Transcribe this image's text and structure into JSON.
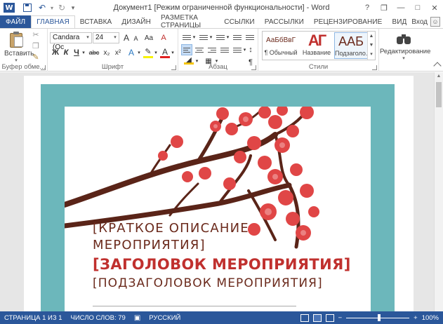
{
  "window": {
    "title": "Документ1 [Режим ограниченной функциональности] - Word",
    "controls": {
      "help": "?",
      "restore": "❐",
      "minimize": "—",
      "maximize": "□",
      "close": "✕"
    }
  },
  "qat": {
    "undo": "↶",
    "redo": "↻",
    "customize": "▾"
  },
  "tabs": [
    {
      "id": "file",
      "label": "ФАЙЛ"
    },
    {
      "id": "home",
      "label": "ГЛАВНАЯ"
    },
    {
      "id": "insert",
      "label": "ВСТАВКА"
    },
    {
      "id": "design",
      "label": "ДИЗАЙН"
    },
    {
      "id": "layout",
      "label": "РАЗМЕТКА СТРАНИЦЫ"
    },
    {
      "id": "references",
      "label": "ССЫЛКИ"
    },
    {
      "id": "mailings",
      "label": "РАССЫЛКИ"
    },
    {
      "id": "review",
      "label": "РЕЦЕНЗИРОВАНИЕ"
    },
    {
      "id": "view",
      "label": "ВИД"
    }
  ],
  "account": {
    "signin": "Вход"
  },
  "ribbon": {
    "clipboard": {
      "label": "Буфер обме...",
      "paste": "Вставить"
    },
    "font": {
      "label": "Шрифт",
      "name": "Candara (Ос",
      "size": "24",
      "bold": "Ж",
      "italic": "К",
      "underline": "Ч",
      "strike": "abc",
      "subscript": "x₂",
      "superscript": "x²",
      "grow": "A",
      "shrink": "A",
      "case": "Aa",
      "clear": "A"
    },
    "paragraph": {
      "label": "Абзац",
      "marks": "¶",
      "sort": "↕"
    },
    "styles": {
      "label": "Стили",
      "items": [
        {
          "sample": "АаБбВвГ",
          "name": "¶ Обычный"
        },
        {
          "sample": "АГ",
          "name": "Название"
        },
        {
          "sample": "ААБ",
          "name": "Подзаголо..."
        }
      ]
    },
    "editing": {
      "label": "Редактирование"
    }
  },
  "document": {
    "summary_line1": "[КРАТКОЕ ОПИСАНИЕ",
    "summary_line2": "МЕРОПРИЯТИЯ]",
    "title": "[ЗАГОЛОВОК МЕРОПРИЯТИЯ]",
    "subtitle": "[ПОДЗАГОЛОВОК МЕРОПРИЯТИЯ]"
  },
  "status": {
    "page": "СТРАНИЦА 1 ИЗ 1",
    "words": "ЧИСЛО СЛОВ: 79",
    "language": "РУССКИЙ",
    "zoom": "100%",
    "zoom_minus": "−",
    "zoom_plus": "+"
  },
  "colors": {
    "accent": "#2b579a",
    "teal": "#6cb7bb",
    "title_red": "#c0302e",
    "text_brown": "#6b2a1c",
    "blossom": "#e04646",
    "branch": "#5a2418"
  }
}
